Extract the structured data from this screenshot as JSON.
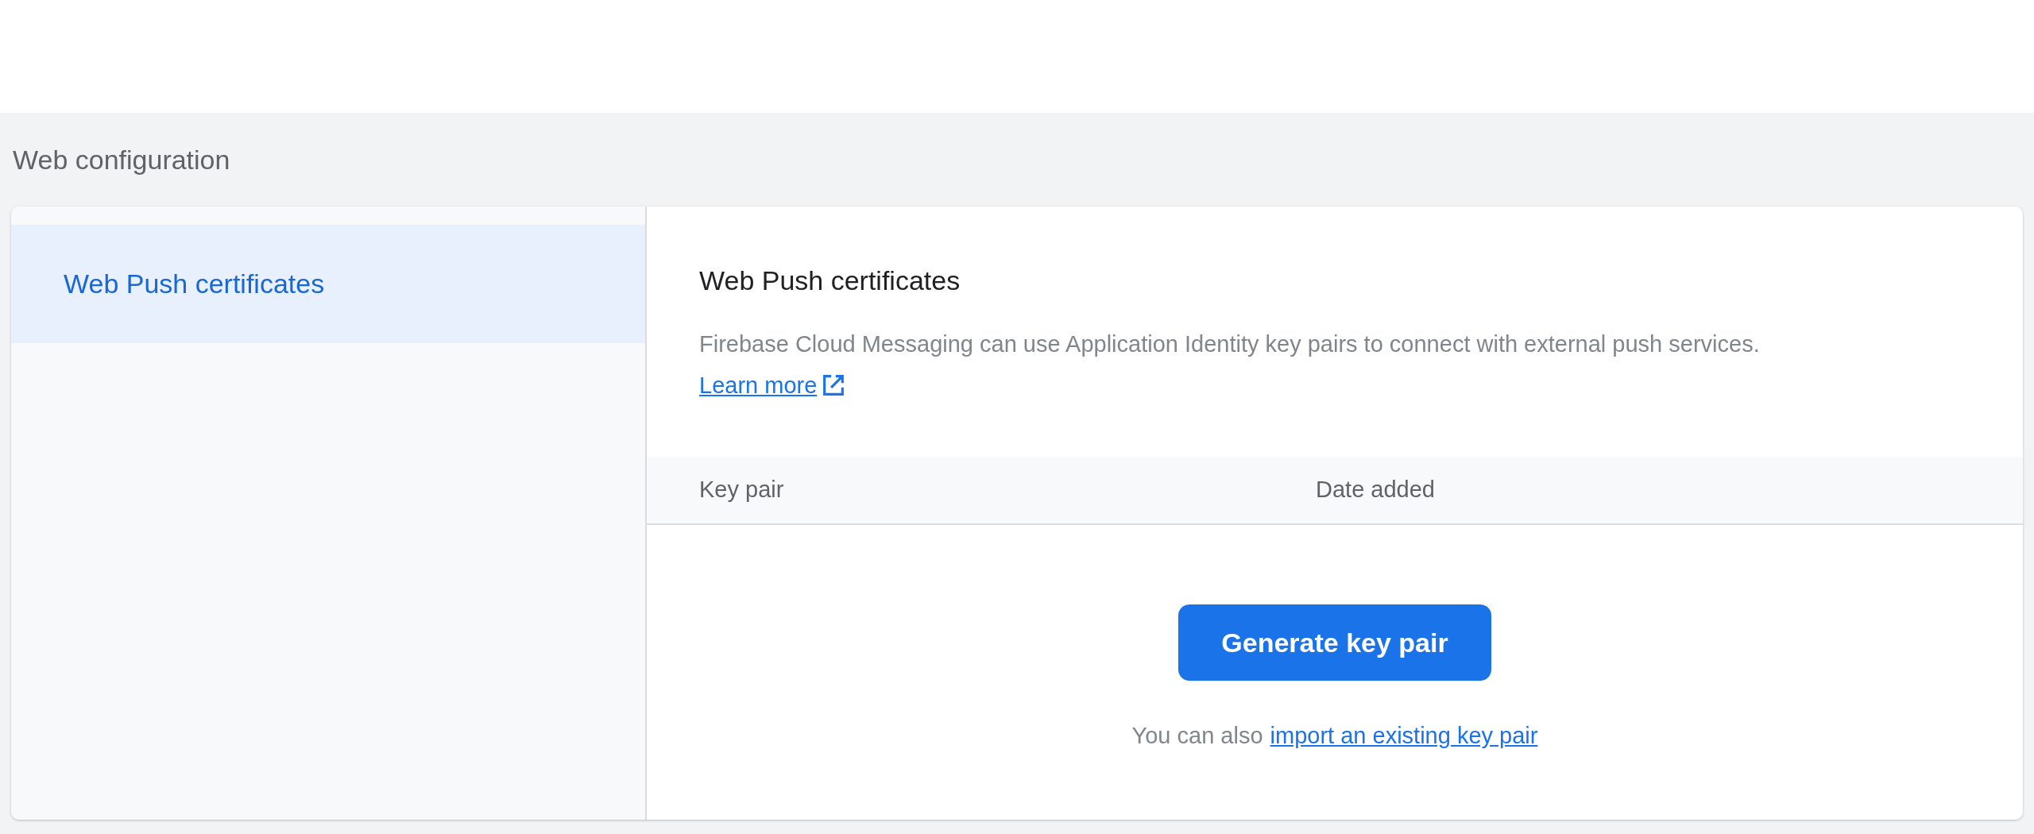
{
  "section_title": "Web configuration",
  "sidebar": {
    "items": [
      {
        "label": "Web Push certificates",
        "selected": true
      }
    ]
  },
  "panel": {
    "title": "Web Push certificates",
    "description": "Firebase Cloud Messaging can use Application Identity key pairs to connect with external push services.",
    "learn_more": "Learn more",
    "table": {
      "columns": [
        "Key pair",
        "Date added"
      ]
    },
    "generate_button": "Generate key pair",
    "import_prefix": "You can also",
    "import_link": "import an existing key pair"
  }
}
